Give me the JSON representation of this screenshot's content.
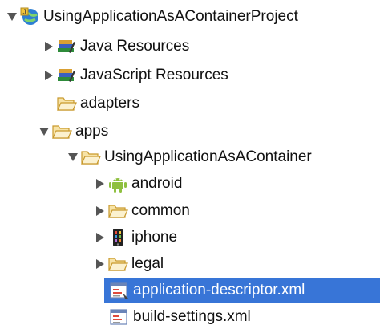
{
  "tree": {
    "project": "UsingApplicationAsAContainerProject",
    "java_resources": "Java Resources",
    "javascript_resources": "JavaScript Resources",
    "adapters": "adapters",
    "apps": "apps",
    "app": "UsingApplicationAsAContainer",
    "android": "android",
    "common": "common",
    "iphone": "iphone",
    "legal": "legal",
    "app_descriptor": "application-descriptor.xml",
    "build_settings": "build-settings.xml"
  },
  "colors": {
    "selection": "#3875d7",
    "folder": "#e9b743",
    "android": "#8fc040"
  }
}
